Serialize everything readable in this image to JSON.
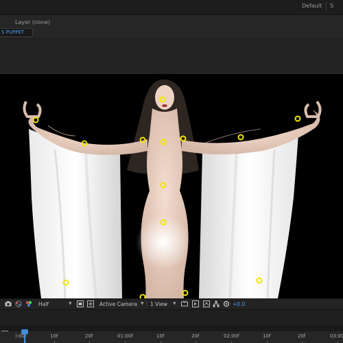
{
  "header": {
    "workspace_default": "Default",
    "workspace_next": "S"
  },
  "panel": {
    "layer_label": "Layer (none)",
    "effect_tab": "S PUPPET"
  },
  "viewer_toolbar": {
    "magnification": "Half",
    "camera": "Active Camera",
    "views": "1 View",
    "exposure": "+0.0"
  },
  "timeline": {
    "ticks": [
      "):00f",
      "10f",
      "20f",
      "01:00f",
      "10f",
      "20f",
      "02:00f",
      "10f",
      "20f",
      "03:00"
    ]
  },
  "colors": {
    "puppet_pin": "#f2e600",
    "accent_blue": "#4a9bf5"
  },
  "icons": [
    "camera-icon",
    "color-icon",
    "region-icon",
    "transparency-grid-icon",
    "view-layout-icon",
    "fast-preview-icon",
    "flowchart-icon",
    "reset-exposure-icon",
    "timeline-icon"
  ]
}
